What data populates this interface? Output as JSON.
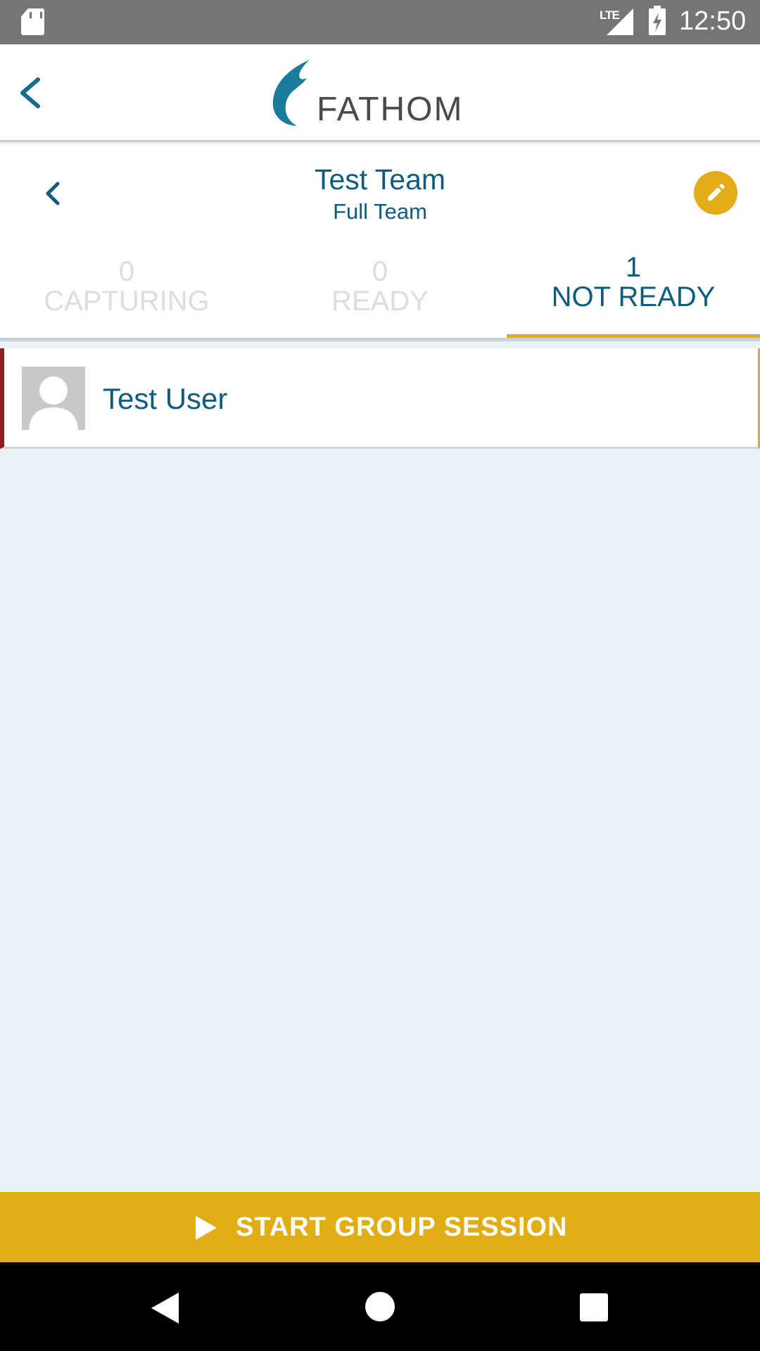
{
  "status_bar": {
    "time": "12:50",
    "network": "LTE"
  },
  "app_bar": {
    "brand": "FATHOM",
    "back_icon": "chevron-left-icon"
  },
  "team": {
    "title": "Test Team",
    "subtitle": "Full Team",
    "edit_icon": "pencil-icon"
  },
  "tabs": [
    {
      "count": "0",
      "label": "CAPTURING",
      "active": false
    },
    {
      "count": "0",
      "label": "READY",
      "active": false
    },
    {
      "count": "1",
      "label": "NOT READY",
      "active": true
    }
  ],
  "members": [
    {
      "name": "Test User",
      "status": "not ready"
    }
  ],
  "cta": {
    "label": "START GROUP SESSION",
    "icon": "play-icon"
  },
  "colors": {
    "primary": "#125b7c",
    "accent": "#e4ad17",
    "not_ready": "#8f1d22",
    "background": "#eaf2f5"
  }
}
